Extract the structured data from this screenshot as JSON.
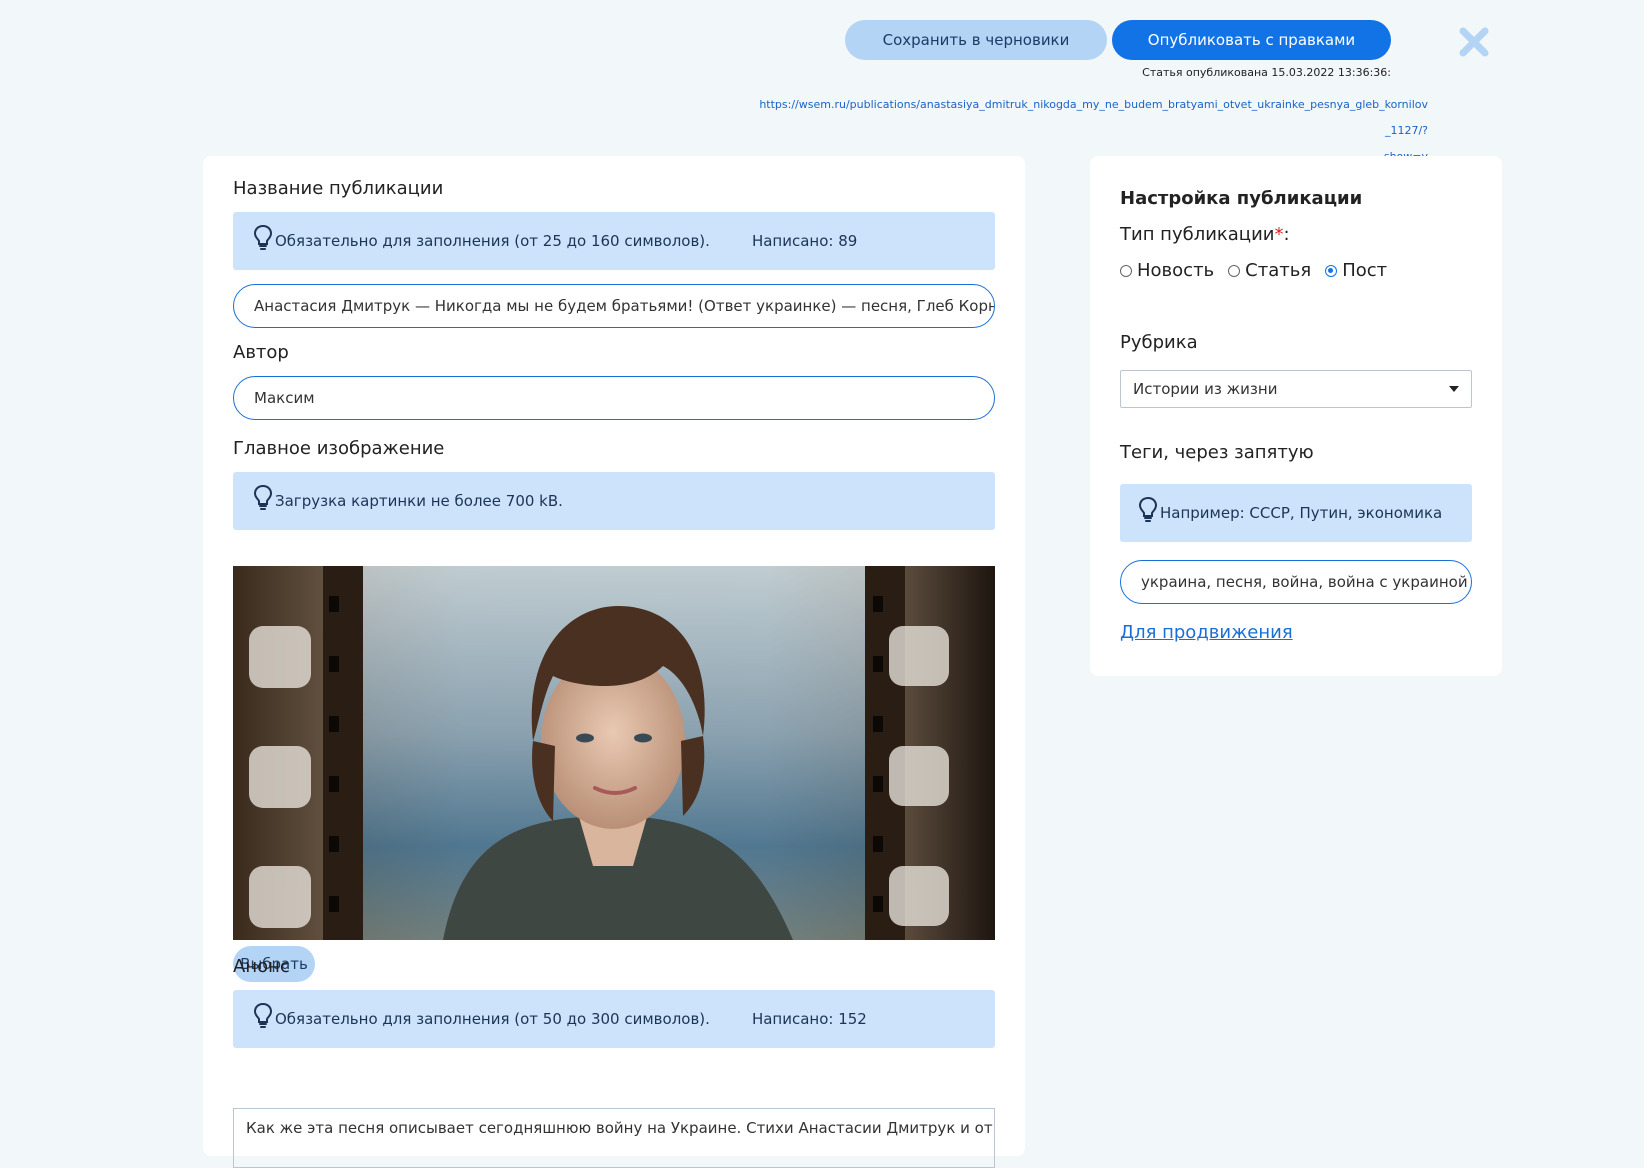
{
  "header": {
    "draft_button": "Сохранить в черновики",
    "publish_button": "Опубликовать с правками",
    "status_text": "Статья опубликована 15.03.2022 13:36:36:",
    "url_line1": "https://wsem.ru/publications/anastasiya_dmitruk_nikogda_my_ne_budem_bratyami_otvet_ukrainke_pesnya_gleb_kornilov_1127/?",
    "url_line2": "show=y"
  },
  "form": {
    "title_label": "Название публикации",
    "title_hint": "Обязательно для заполнения (от 25 до 160 символов).",
    "title_count": "Написано: 89",
    "title_value": "Анастасия Дмитрук — Никогда мы не будем братьями! (Ответ украинке) — песня, Глеб Корнилов",
    "author_label": "Автор",
    "author_value": "Максим",
    "image_label": "Главное изображение",
    "image_hint": "Загрузка картинки не более 700 kB.",
    "choose_button": "Выбрать",
    "anons_label": "Анонс",
    "anons_hint": "Обязательно для заполнения (от 50 до 300 символов).",
    "anons_count": "Написано: 152",
    "anons_value": "Как же эта песня описывает сегодняшнюю войну на Украине. Стихи Анастасии Дмитрук и ответ украинке"
  },
  "settings": {
    "title": "Настройка публикации",
    "type_label": "Тип публикации",
    "type_required_mark": "*",
    "type_colon": ":",
    "types": [
      {
        "label": "Новость",
        "checked": false
      },
      {
        "label": "Статья",
        "checked": false
      },
      {
        "label": "Пост",
        "checked": true
      }
    ],
    "rubric_label": "Рубрика",
    "rubric_value": "Истории из жизни",
    "tags_label": "Теги, через запятую",
    "tags_hint": "Например: СССР, Путин, экономика",
    "tags_value": "украина, песня, война, война с украиной",
    "promo_link": "Для продвижения"
  },
  "colors": {
    "accent": "#1173e6",
    "hint_bg": "#cce3fb",
    "secondary_button": "#b3d4f5",
    "page_bg": "#f2f7fa"
  }
}
